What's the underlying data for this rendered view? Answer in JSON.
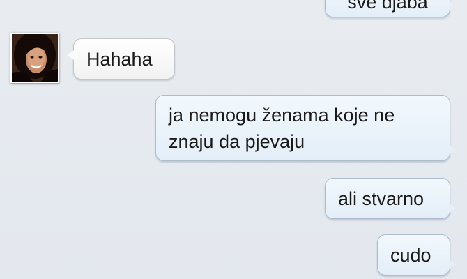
{
  "conversation": {
    "messages": [
      {
        "direction": "outgoing",
        "text": "sve djaba"
      },
      {
        "direction": "incoming",
        "text": "Hahaha"
      },
      {
        "direction": "outgoing",
        "lines": [
          "ja nemogu ženama koje ne",
          "znaju da pjevaju"
        ]
      },
      {
        "direction": "outgoing",
        "text": "ali stvarno"
      },
      {
        "direction": "outgoing",
        "text": "cudo"
      }
    ]
  },
  "avatar_icon": "contact-photo",
  "colors": {
    "background": "#e6eaef",
    "outgoing_bubble": "#e4eef8",
    "incoming_bubble": "#ffffff"
  }
}
